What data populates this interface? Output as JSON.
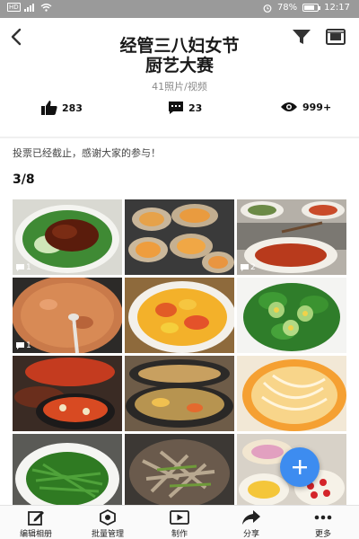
{
  "status_bar": {
    "network": "HD",
    "battery": "78%",
    "battery_level": 0.78,
    "time": "12:17"
  },
  "header": {
    "title_line1": "经管三八妇女节",
    "title_line2": "厨艺大赛",
    "subtitle": "41照片/视频",
    "stats": {
      "likes": "283",
      "comments": "23",
      "views": "999+"
    }
  },
  "notice": "投票已经截止，感谢大家的参与！",
  "page_indicator": "3/8",
  "photos": [
    {
      "label": "braised-pork-with-bok-choy",
      "comments": "1"
    },
    {
      "label": "grilled-oysters",
      "comments": ""
    },
    {
      "label": "mixed-dishes-collage",
      "comments": "2"
    },
    {
      "label": "tomato-soup",
      "comments": "1"
    },
    {
      "label": "tomato-scrambled-eggs",
      "comments": ""
    },
    {
      "label": "steamed-egg-on-greens",
      "comments": ""
    },
    {
      "label": "hot-pot-dishes",
      "comments": ""
    },
    {
      "label": "stew-pot",
      "comments": ""
    },
    {
      "label": "noodle-soup",
      "comments": ""
    },
    {
      "label": "stir-fried-greens",
      "comments": ""
    },
    {
      "label": "stir-fried-vegetables",
      "comments": ""
    },
    {
      "label": "dessert-plates",
      "comments": ""
    }
  ],
  "toolbar": {
    "edit_album": "编辑相册",
    "batch_manage": "批量管理",
    "create": "制作",
    "share": "分享",
    "more": "更多"
  },
  "colors": {
    "accent": "#3d8cf0",
    "status_bar": "#9a9a9a"
  }
}
